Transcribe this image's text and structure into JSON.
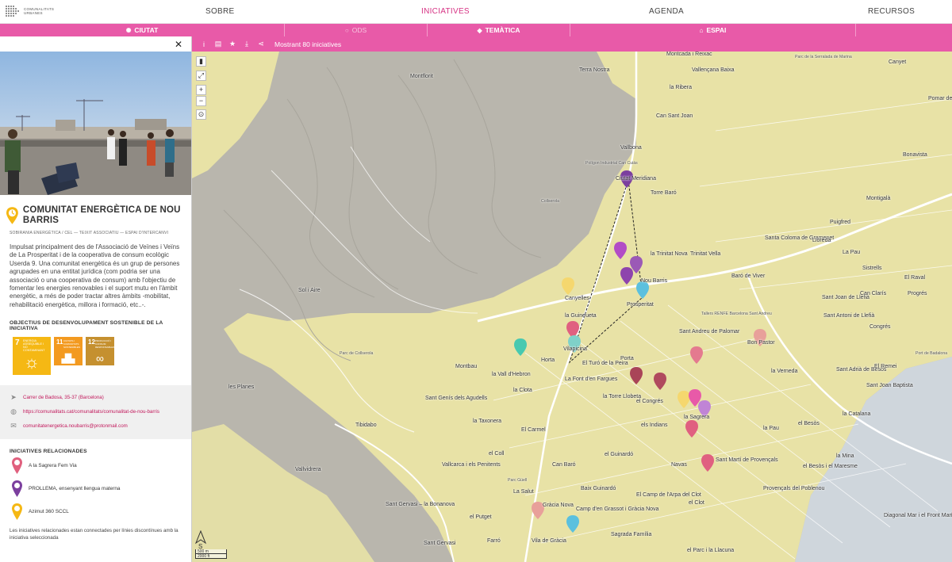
{
  "app": {
    "logo_text_1": "COMUNALITATS",
    "logo_text_2": "URBANES"
  },
  "nav": {
    "items": [
      "SOBRE",
      "INICIATIVES",
      "AGENDA",
      "RECURSOS"
    ],
    "active": "INICIATIVES"
  },
  "filters": {
    "ciutat": "CIUTAT",
    "ods": "ODS",
    "tematica": "TEMÀTICA",
    "espai": "ESPAI"
  },
  "toolbar": {
    "count_text": "Mostrant 80 iniciatives"
  },
  "panel": {
    "title": "COMUNITAT ENERGÈTICA DE NOU BARRIS",
    "tags": "SOBIRANIA ENERGÈTICA / CEL — TEIXIT ASSOCIATIU — ESPAI D'INTERCANVI",
    "description": "Impulsat principalment des de l'Associació de Veïnes i Veïns de La Prosperitat i de la cooperativa de consum ecològic Userda 9. Una comunitat energètica és un grup de persones agrupades en una entitat jurídica (com podria ser una associació o una cooperativa de consum) amb l'objectiu de fomentar les energies renovables i el suport mutu en l'àmbit energètic, a més de poder tractar altres àmbits -mobilitat, rehabilitació energètica, millora i formació, etc..-.",
    "ods_title": "OBJECTIUS DE DESENVOLUPAMENT SOSTENIBLE DE LA INICIATIVA",
    "ods": [
      {
        "num": "7",
        "label": "ENERGIA ASSEQUIBLE I NO CONTAMINANT",
        "color": "#f5b814"
      },
      {
        "num": "11",
        "label": "CIUTATS I COMUNITATS SOSTENIBLES",
        "color": "#f39a20"
      },
      {
        "num": "12",
        "label": "PRODUCCIÓ I CONSUM RESPONSABLES",
        "color": "#c5902f"
      }
    ],
    "address": "Carrer de Badosa, 35-37 (Barcelona)",
    "url": "https://comunalitats.cat/comunalitats/comunalitat-de-nou-barris",
    "email": "comunitatenergetica.noubarris@protonmail.com",
    "related_title": "INICIATIVES RELACIONADES",
    "related": [
      {
        "name": "A la Sagrera Fem Via",
        "color": "#e0607e"
      },
      {
        "name": "PROLLEMA, ensenyant llengua materna",
        "color": "#7b3f9e"
      },
      {
        "name": "Azimut 360 SCCL",
        "color": "#f5b814"
      }
    ],
    "footnote": "Les iniciatives relacionades estan connectades per línies discontínues amb la iniciativa seleccionada"
  },
  "map": {
    "labels": [
      "Torre Baró",
      "Ciutat Meridiana",
      "Vallbona",
      "Can Sant Joan",
      "Vallençana Baixa",
      "la Ribera",
      "Montflorit",
      "Terra Nostra",
      "Montcada i Reixac",
      "Polígon Industrial Can Cuiàs",
      "Collserola",
      "Sol i Aire",
      "Parc de Collserola",
      "les Planes",
      "Tibidabo",
      "Vallvidrera",
      "la Trinitat Nova",
      "Trinitat Vella",
      "Nou Barris",
      "Prosperitat",
      "la Guineueta",
      "Canyelles",
      "Vilapicina",
      "Porta",
      "Horta",
      "El Turó de la Peira",
      "la Vall d'Hebron",
      "Montbau",
      "Sant Genís dels Agudells",
      "la Clota",
      "La Font d'en Fargues",
      "la Taxonera",
      "El Carmel",
      "el Coll",
      "Vallcarca i els Penitents",
      "Can Baró",
      "el Guinardó",
      "Parc Güell",
      "La Salut",
      "el Putget",
      "Gràcia Nova",
      "Sant Gervasi – la Bonanova",
      "Farró",
      "Sant Gervasi",
      "Vila de Gràcia",
      "Camp d'en Grassot i Gràcia Nova",
      "Sagrada Família",
      "Baix Guinardó",
      "El Camp de l'Arpa del Clot",
      "el Clot",
      "Navas",
      "la Sagrera",
      "el Congrés",
      "els Indians",
      "la Torre Llobeta",
      "Sant Andreu de Palomar",
      "Bon Pastor",
      "Baró de Viver",
      "Santa Coloma de Gramenet",
      "la Verneda",
      "Sant Martí de Provençals",
      "Provençals del Poblenou",
      "el Besòs i el Maresme",
      "la Mina",
      "el Besòs",
      "la Pau",
      "Sant Adrià de Besòs",
      "la Catalana",
      "Sant Joan Baptista",
      "El Remei",
      "Congrés",
      "Sant Antoni de Llefià",
      "Sant Joan de Llefià",
      "Can Clarís",
      "Progrés",
      "El Raval",
      "Sistrells",
      "Pomar de Dalt",
      "Canyet",
      "Bonavista",
      "Montigalà",
      "Puigfred",
      "Lloreda",
      "La Pau",
      "Diagonal Mar i el Front Marítim del Poblenou",
      "el Parc i la Llacuna",
      "Tallers RENFE Barcelona Sant Andreu",
      "Port de Badalona",
      "Parc de la Serralada de Marina"
    ],
    "scale_m": "500 m",
    "scale_ft": "2000 ft"
  }
}
